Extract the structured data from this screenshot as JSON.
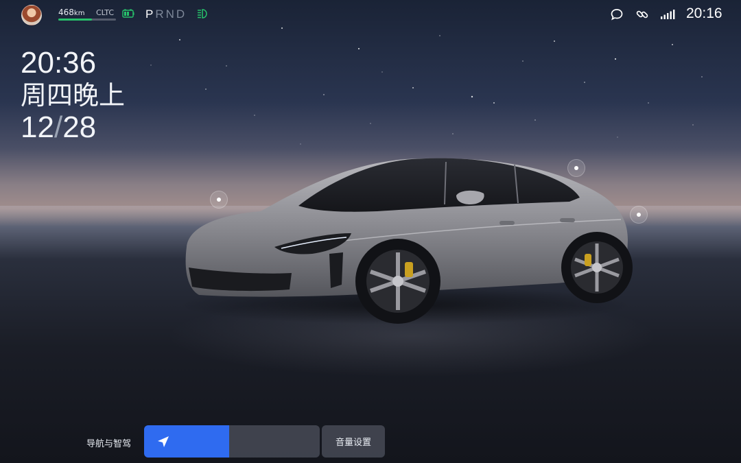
{
  "status_bar": {
    "range_value": "468",
    "range_unit": "km",
    "range_standard": "CLTC",
    "range_fill_fraction": 0.58,
    "gears": [
      "P",
      "R",
      "N",
      "D"
    ],
    "active_gear": "P",
    "icons": [
      "avatar",
      "battery-icon",
      "headlight-icon",
      "chat-icon",
      "link-icon",
      "signal-icon"
    ],
    "time": "20:16",
    "accent_green": "#27c26b"
  },
  "clock": {
    "time": "20:36",
    "day": "周四晚上",
    "date_month": "12",
    "date_day": "28"
  },
  "dock": {
    "nav_label": "导航与智驾",
    "volume_label": "音量设置",
    "accent_blue": "#2f6bf0"
  }
}
